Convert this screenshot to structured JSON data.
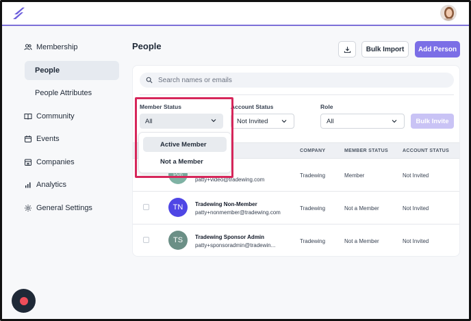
{
  "app": {
    "brand_color": "#7b6ee6",
    "highlight_color": "#d6265a"
  },
  "sidebar": {
    "items": [
      {
        "label": "Membership",
        "icon": "users-icon"
      },
      {
        "label": "People",
        "active": true
      },
      {
        "label": "People Attributes"
      },
      {
        "label": "Community",
        "icon": "book-icon"
      },
      {
        "label": "Events",
        "icon": "calendar-icon"
      },
      {
        "label": "Companies",
        "icon": "building-icon"
      },
      {
        "label": "Analytics",
        "icon": "bar-chart-icon"
      },
      {
        "label": "General Settings",
        "icon": "gear-icon"
      }
    ]
  },
  "header": {
    "title": "People",
    "download_icon": "download-icon",
    "bulk_import_label": "Bulk Import",
    "add_person_label": "Add Person"
  },
  "search": {
    "placeholder": "Search names or emails"
  },
  "filters": {
    "member_status": {
      "label": "Member Status",
      "value": "All"
    },
    "account_status": {
      "label": "Account Status",
      "value": "Not Invited"
    },
    "role": {
      "label": "Role",
      "value": "All"
    },
    "bulk_invite_label": "Bulk Invite"
  },
  "dropdown": {
    "options": [
      "Active Member",
      "Not a Member"
    ]
  },
  "table": {
    "columns": [
      "COMPANY",
      "MEMBER STATUS",
      "ACCOUNT STATUS"
    ],
    "rows": [
      {
        "initials": "Pvp",
        "color": "#7fb2a4",
        "name": "",
        "email": "patty+video@tradewing.com",
        "company": "Tradewing",
        "member_status": "Member",
        "account_status": "Not Invited"
      },
      {
        "initials": "TN",
        "color": "#4f46e5",
        "name": "Tradewing Non-Member",
        "email": "patty+nonmember@tradewing.com",
        "company": "Tradewing",
        "member_status": "Not a Member",
        "account_status": "Not Invited"
      },
      {
        "initials": "TS",
        "color": "#6b8f86",
        "name": "Tradewing Sponsor Admin",
        "email": "patty+sponsoradmin@tradewin...",
        "company": "Tradewing",
        "member_status": "Not a Member",
        "account_status": "Not Invited"
      }
    ]
  }
}
